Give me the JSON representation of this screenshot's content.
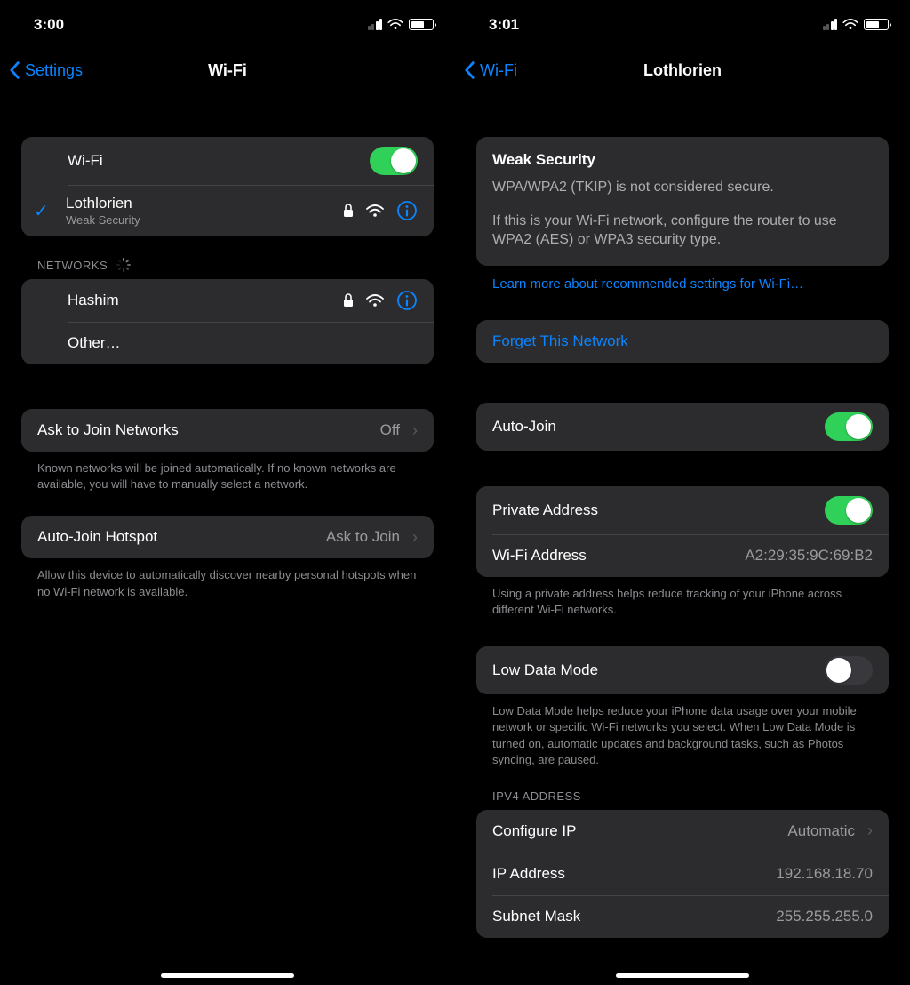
{
  "left": {
    "status": {
      "time": "3:00"
    },
    "nav": {
      "back": "Settings",
      "title": "Wi-Fi"
    },
    "wifi_toggle_label": "Wi-Fi",
    "connected": {
      "name": "Lothlorien",
      "sub": "Weak Security"
    },
    "networks_header": "NETWORKS",
    "networks": [
      {
        "name": "Hashim"
      }
    ],
    "other": "Other…",
    "ask_join": {
      "label": "Ask to Join Networks",
      "value": "Off",
      "footer": "Known networks will be joined automatically. If no known networks are available, you will have to manually select a network."
    },
    "hotspot": {
      "label": "Auto-Join Hotspot",
      "value": "Ask to Join",
      "footer": "Allow this device to automatically discover nearby personal hotspots when no Wi-Fi network is available."
    }
  },
  "right": {
    "status": {
      "time": "3:01"
    },
    "nav": {
      "back": "Wi-Fi",
      "title": "Lothlorien"
    },
    "warning": {
      "title": "Weak Security",
      "line1": "WPA/WPA2 (TKIP) is not considered secure.",
      "line2": "If this is your Wi-Fi network, configure the router to use WPA2 (AES) or WPA3 security type."
    },
    "learn_more": "Learn more about recommended settings for Wi-Fi…",
    "forget": "Forget This Network",
    "auto_join": "Auto-Join",
    "private_addr": "Private Address",
    "wifi_addr": {
      "label": "Wi-Fi Address",
      "value": "A2:29:35:9C:69:B2"
    },
    "private_footer": "Using a private address helps reduce tracking of your iPhone across different Wi-Fi networks.",
    "low_data": "Low Data Mode",
    "low_data_footer": "Low Data Mode helps reduce your iPhone data usage over your mobile network or specific Wi-Fi networks you select. When Low Data Mode is turned on, automatic updates and background tasks, such as Photos syncing, are paused.",
    "ipv4_header": "IPV4 ADDRESS",
    "configure_ip": {
      "label": "Configure IP",
      "value": "Automatic"
    },
    "ip_addr": {
      "label": "IP Address",
      "value": "192.168.18.70"
    },
    "subnet": {
      "label": "Subnet Mask",
      "value": "255.255.255.0"
    }
  }
}
